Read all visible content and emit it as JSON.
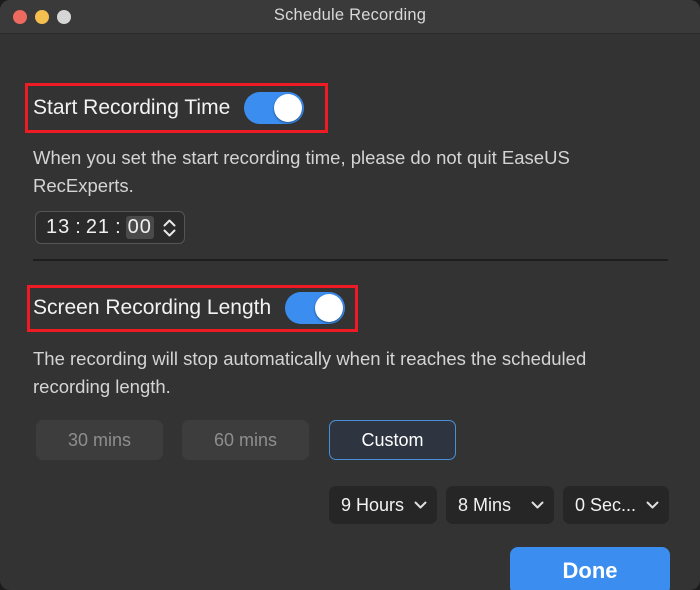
{
  "window": {
    "title": "Schedule Recording",
    "traffic_lights": [
      {
        "name": "close",
        "color": "#ed6a5f"
      },
      {
        "name": "minimize",
        "color": "#f5bf4f"
      },
      {
        "name": "zoom",
        "color": "#d6d6d6"
      }
    ],
    "background": "#333333",
    "accent": "#3b8ef0",
    "annotation_color": "#ee1b24"
  },
  "start_time_section": {
    "label": "Start Recording Time",
    "toggle_state": "on",
    "description": "When you set the start recording time, please do not quit EaseUS RecExperts.",
    "time": {
      "hours": "13",
      "minutes": "21",
      "seconds": "00",
      "separator": ":"
    }
  },
  "length_section": {
    "label": "Screen Recording Length",
    "toggle_state": "on",
    "description": "The recording will stop automatically when it reaches the scheduled recording length.",
    "presets": [
      {
        "label": "30 mins",
        "selected": false
      },
      {
        "label": "60 mins",
        "selected": false
      },
      {
        "label": "Custom",
        "selected": true
      }
    ],
    "duration": {
      "hours": "9 Hours",
      "minutes": "8 Mins",
      "seconds": "0 Sec..."
    }
  },
  "footer": {
    "done_label": "Done"
  }
}
